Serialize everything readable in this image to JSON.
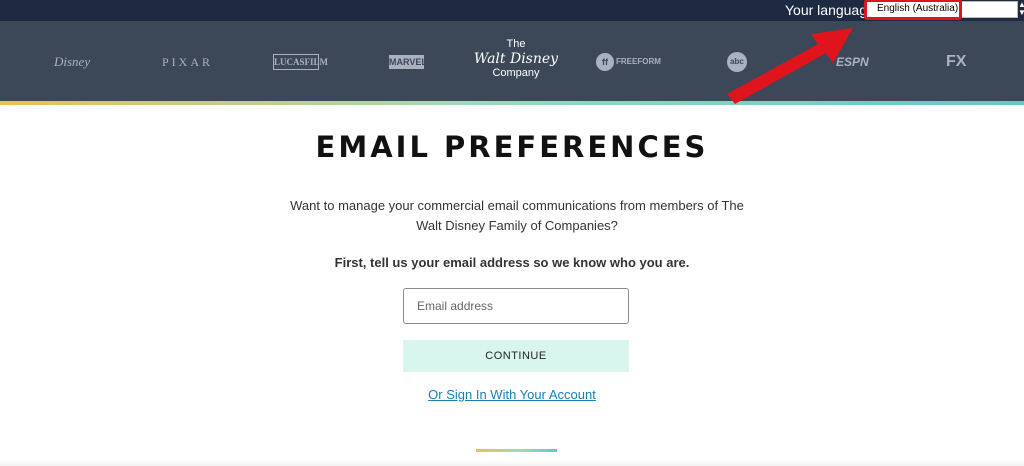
{
  "language_bar": {
    "label": "Your language:",
    "selected_language": "English (Australia)",
    "highlight_color": "#e0141c"
  },
  "brands": {
    "disney": "Disney",
    "pixar": "PIXAR",
    "lucasfilm": "LUCASFILM",
    "marvel": "MARVEL",
    "twdc_the": "The",
    "twdc_name": "Walt Disney",
    "twdc_company": "Company",
    "freeform_icon": "ff",
    "freeform": "FREEFORM",
    "abc": "abc",
    "espn": "ESPN",
    "fx": "FX"
  },
  "main": {
    "title": "EMAIL PREFERENCES",
    "intro": "Want to manage your commercial email communications from members of The Walt Disney Family of Companies?",
    "subtitle": "First, tell us your email address so we know who you are.",
    "email_placeholder": "Email address",
    "email_value": "",
    "continue_label": "CONTINUE",
    "signin_label": "Or Sign In With Your Account"
  },
  "colors": {
    "top_bar": "#1d2a42",
    "brand_bar": "#3c4758",
    "continue_bg": "#d9f6ee",
    "link": "#1a7fb5",
    "annotation_arrow": "#e0141c"
  },
  "icons": [
    "red-pointer-arrow-icon",
    "select-arrows-icon"
  ]
}
